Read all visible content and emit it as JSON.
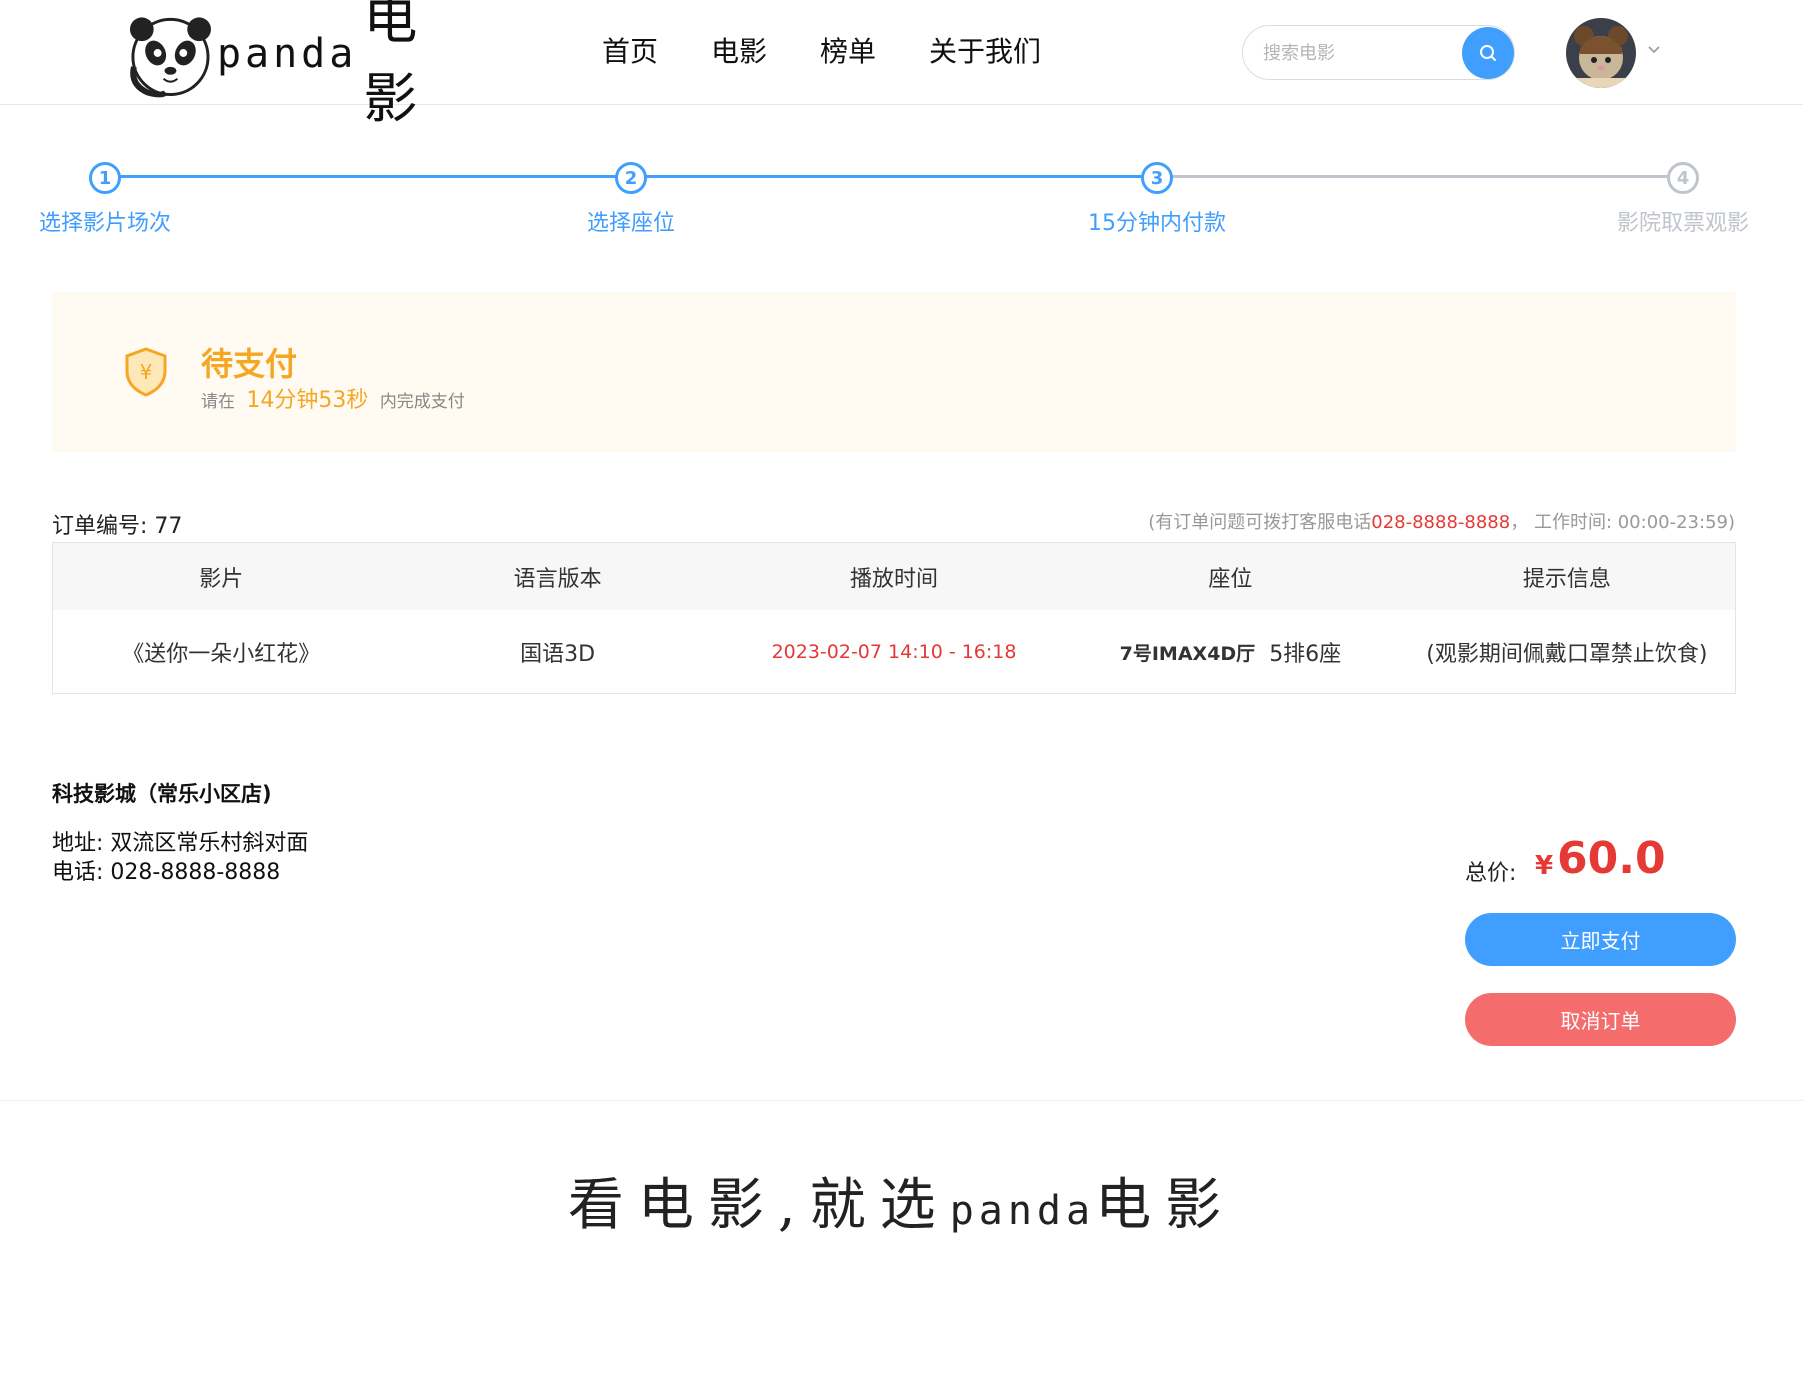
{
  "header": {
    "logo_en": "panda",
    "logo_cn": "电影",
    "nav": [
      "首页",
      "电影",
      "榜单",
      "关于我们"
    ],
    "search_placeholder": "搜索电影"
  },
  "steps": [
    {
      "num": "1",
      "label": "选择影片场次",
      "state": "done"
    },
    {
      "num": "2",
      "label": "选择座位",
      "state": "done"
    },
    {
      "num": "3",
      "label": "15分钟内付款",
      "state": "active"
    },
    {
      "num": "4",
      "label": "影院取票观影",
      "state": "todo"
    }
  ],
  "banner": {
    "title": "待支付",
    "sub_prefix": "请在",
    "countdown": "14分钟53秒",
    "sub_suffix": "内完成支付"
  },
  "order": {
    "number_label": "订单编号: 77",
    "service_prefix": "(有订单问题可拨打客服电话",
    "service_phone": "028-8888-8888",
    "service_suffix": "， 工作时间: 00:00-23:59)",
    "columns": [
      "影片",
      "语言版本",
      "播放时间",
      "座位",
      "提示信息"
    ],
    "row": {
      "movie": "《送你一朵小红花》",
      "language": "国语3D",
      "time": "2023-02-07 14:10 - 16:18",
      "hall": "7号IMAX4D厅",
      "seat": "5排6座",
      "tip": "(观影期间佩戴口罩禁止饮食)"
    }
  },
  "cinema": {
    "name": "科技影城（常乐小区店)",
    "address": "地址: 双流区常乐村斜对面",
    "phone": "电话: 028-8888-8888"
  },
  "payment": {
    "total_label": "总价:",
    "currency": "¥",
    "amount": "60.0",
    "pay_label": "立即支付",
    "cancel_label": "取消订单"
  },
  "footer": {
    "slogan_pre": "看电影,就选",
    "slogan_en": "panda",
    "slogan_post": "电影"
  },
  "colors": {
    "primary": "#409eff",
    "warning": "#f5a623",
    "danger": "#e53935",
    "cancel": "#f56c6c",
    "inactive": "#c0c4cc"
  }
}
